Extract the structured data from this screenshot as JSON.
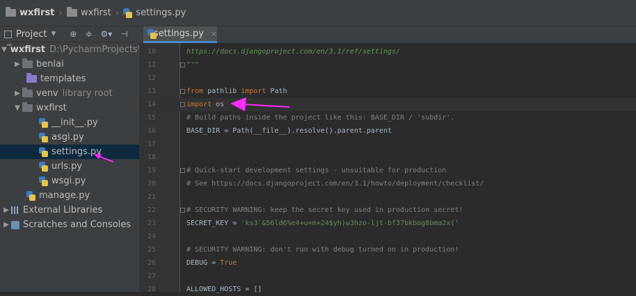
{
  "breadcrumb": {
    "project": "wxfirst",
    "folder": "wxfirst",
    "file": "settings.py"
  },
  "project_panel": {
    "title": "Project",
    "dropdown_icon": "triangle-down-icon",
    "tools": [
      "target-icon",
      "collapse-icon",
      "gear-icon",
      "hide-icon"
    ],
    "root": {
      "name": "wxfirst",
      "path": "D:\\PycharmProjects\\"
    },
    "items": [
      {
        "label": "benlai",
        "icon": "folder-icon"
      },
      {
        "label": "templates",
        "icon": "purple-folder-icon"
      },
      {
        "label": "venv",
        "note": "library root",
        "icon": "folder-icon"
      },
      {
        "label": "wxfirst",
        "icon": "folder-icon"
      },
      {
        "label": "__init__.py",
        "icon": "python-file-icon"
      },
      {
        "label": "asgi.py",
        "icon": "python-file-icon"
      },
      {
        "label": "settings.py",
        "icon": "python-file-icon"
      },
      {
        "label": "urls.py",
        "icon": "python-file-icon"
      },
      {
        "label": "wsgi.py",
        "icon": "python-file-icon"
      },
      {
        "label": "manage.py",
        "icon": "python-file-icon"
      },
      {
        "label": "External Libraries",
        "icon": "libraries-icon"
      },
      {
        "label": "Scratches and Consoles",
        "icon": "scratches-icon"
      }
    ]
  },
  "tab": {
    "label": "settings.py",
    "close": "×"
  },
  "editor": {
    "lines": [
      {
        "num": "10",
        "text": "https://docs.djangoproject.com/en/3.1/ref/settings/"
      },
      {
        "num": "11",
        "text": "\"\"\""
      },
      {
        "num": "12",
        "text": ""
      },
      {
        "num": "13",
        "kw1": "from",
        "mid": " pathlib ",
        "kw2": "import",
        "rest": " Path"
      },
      {
        "num": "14",
        "kw1": "import",
        "rest": " os"
      },
      {
        "num": "15",
        "text": "# Build paths inside the project like this: BASE_DIR / 'subdir'."
      },
      {
        "num": "16",
        "text": "BASE_DIR = Path(__file__).resolve().parent.parent"
      },
      {
        "num": "17",
        "text": ""
      },
      {
        "num": "18",
        "text": ""
      },
      {
        "num": "19",
        "text": "# Quick-start development settings - unsuitable for production"
      },
      {
        "num": "20",
        "text": "# See https://docs.djangoproject.com/en/3.1/howto/deployment/checklist/"
      },
      {
        "num": "21",
        "text": ""
      },
      {
        "num": "22",
        "text": "# SECURITY WARNING: keep the secret key used in production secret!"
      },
      {
        "num": "23",
        "pre": "SECRET_KEY = ",
        "str": "'ks3`&56ld6%e4+u=m+24$yh)w3hzo-ljt-bf37bkbog8bma2x('"
      },
      {
        "num": "24",
        "text": ""
      },
      {
        "num": "25",
        "text": "# SECURITY WARNING: don't run with debug turned on in production!"
      },
      {
        "num": "26",
        "pre": "DEBUG = ",
        "kw": "True"
      },
      {
        "num": "27",
        "text": ""
      },
      {
        "num": "28",
        "text": "ALLOWED_HOSTS = []"
      }
    ]
  },
  "colors": {
    "annotation_arrow": "#ff2bff",
    "keyword": "#cc7832",
    "comment": "#808080",
    "string": "#6a8759",
    "docstring": "#629755",
    "selection": "#0d293e"
  }
}
